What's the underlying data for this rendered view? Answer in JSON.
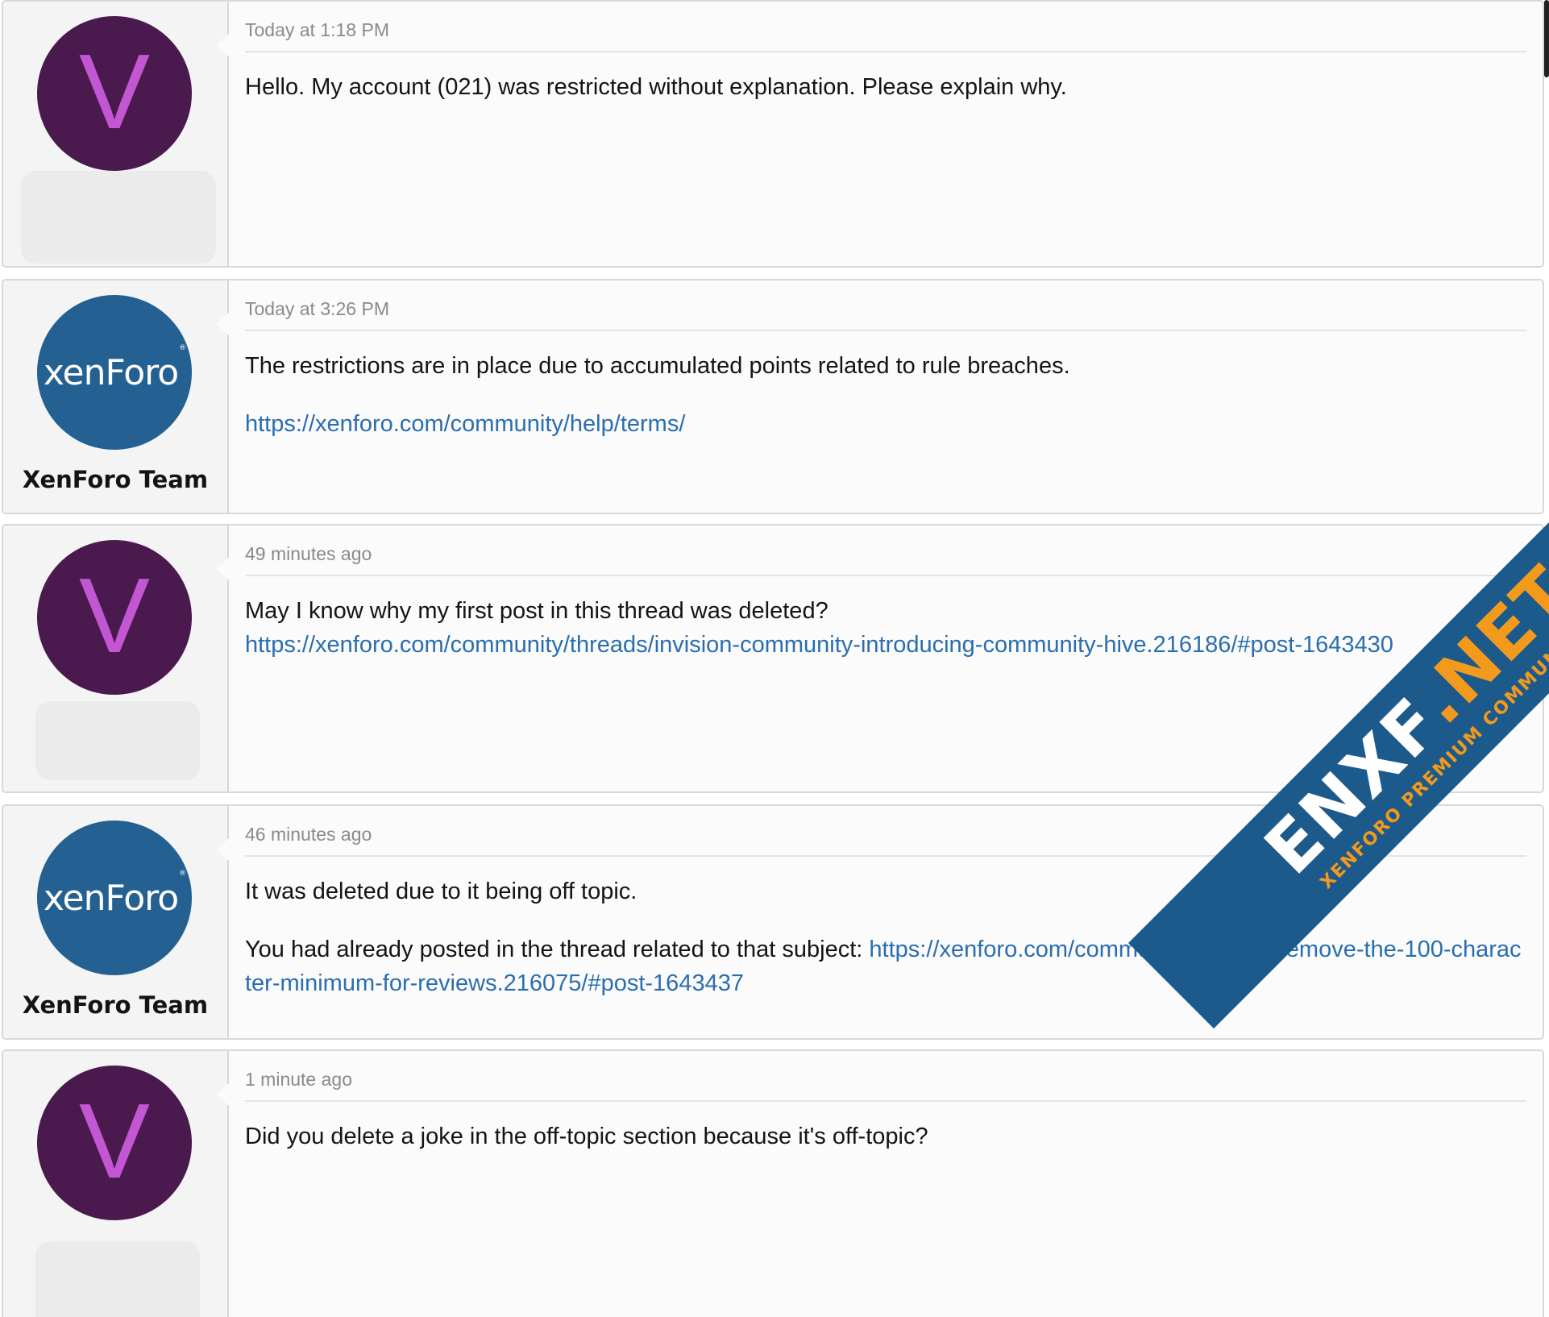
{
  "messages": [
    {
      "author": "V",
      "avatar_letter": "V",
      "date": "Today at 1:18 PM",
      "paragraphs": [
        "Hello. My account (021) was restricted without explanation. Please explain why."
      ]
    },
    {
      "author": "XenForo Team",
      "avatar_logo": "xenForo",
      "date": "Today at 3:26 PM",
      "paragraph_1": "The restrictions are in place due to accumulated points related to rule breaches.",
      "link_1": "https://xenforo.com/community/help/terms/"
    },
    {
      "author": "V",
      "avatar_letter": "V",
      "date": "49 minutes ago",
      "paragraph_1": "May I know why my first post in this thread was deleted?",
      "link_1": "https://xenforo.com/community/threads/invision-community-introducing-community-hive.216186/#post-1643430"
    },
    {
      "author": "XenForo Team",
      "avatar_logo": "xenForo",
      "date": "46 minutes ago",
      "paragraph_1": "It was deleted due to it being off topic.",
      "paragraph_2_prefix": "You had already posted in the thread related to that subject: ",
      "link_1": "https://xenforo.com/community/threads/remove-the-100-character-minimum-for-reviews.216075/#post-1643437"
    },
    {
      "author": "V",
      "avatar_letter": "V",
      "date": "1 minute ago",
      "paragraph_1": "Did you delete a joke in the off-topic section because it's off-topic?"
    }
  ],
  "watermark": {
    "brand_main": "ENXF",
    "brand_tld": ".NET",
    "tagline": "XENFORO PREMIUM COMMUNITY"
  },
  "colors": {
    "v_avatar_bg": "#4a1a4e",
    "v_avatar_letter": "#c356d3",
    "xf_avatar_bg": "#256093",
    "link": "#2a6eb0",
    "watermark_bg": "#1d5a8c",
    "watermark_accent": "#f39a1c"
  }
}
